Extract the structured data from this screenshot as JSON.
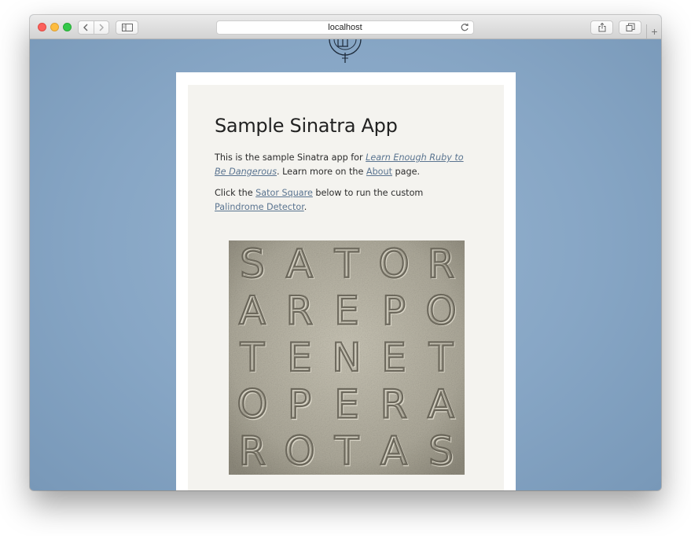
{
  "browser": {
    "url": "localhost",
    "new_tab_glyph": "+",
    "icons": [
      "close-icon",
      "minimize-icon",
      "zoom-icon",
      "back-icon",
      "forward-icon",
      "sidebar-icon",
      "reload-icon",
      "share-icon",
      "tabs-icon",
      "new-tab-icon"
    ]
  },
  "page": {
    "heading": "Sample Sinatra App",
    "intro": {
      "before": "This is the sample Sinatra app for ",
      "book_link": "Learn Enough Ruby to Be Dangerous",
      "middle": ". Learn more on the ",
      "about_link": "About",
      "after": " page."
    },
    "instruction": {
      "before": "Click the ",
      "sator_link": "Sator Square",
      "middle": " below to run the custom ",
      "detector_link": "Palindrome Detector",
      "after": "."
    },
    "sator_rows": [
      "SATOR",
      "AREPO",
      "TENET",
      "OPERA",
      "ROTAS"
    ]
  },
  "colors": {
    "background": "#8aa9c7",
    "card": "#ffffff",
    "content_panel": "#f4f3ef",
    "link": "#5a7490",
    "stone": "#a8a597"
  }
}
